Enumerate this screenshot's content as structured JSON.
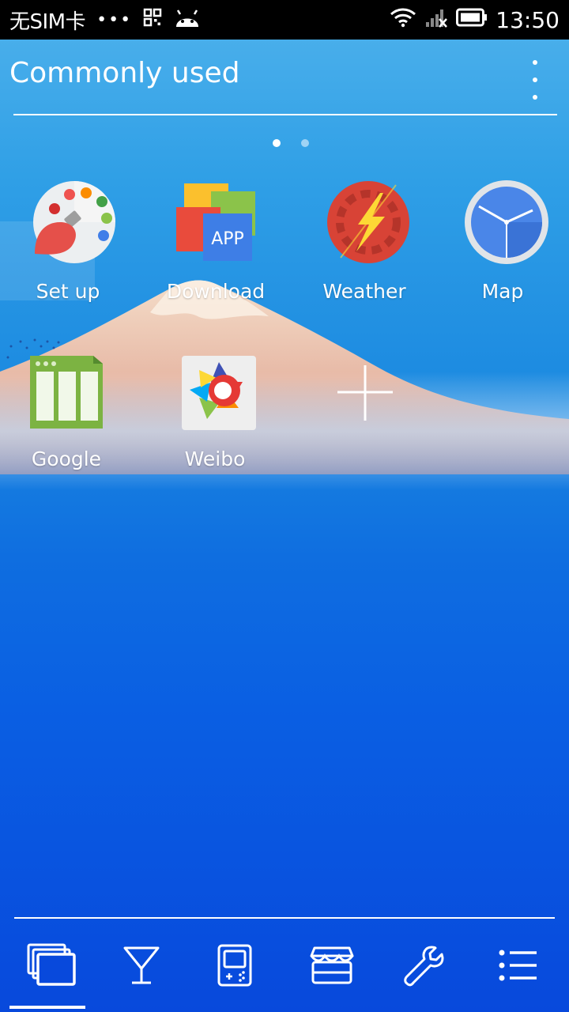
{
  "status_bar": {
    "carrier": "无SIM卡",
    "dots": "•••",
    "time": "13:50"
  },
  "header": {
    "title": "Commonly used",
    "menu_icon": "more-vert-icon"
  },
  "page_indicator": {
    "count": 2,
    "active_index": 0
  },
  "apps": [
    {
      "label": "Set up",
      "icon": "palette-icon"
    },
    {
      "label": "Download",
      "icon": "app-store-icon"
    },
    {
      "label": "Weather",
      "icon": "lightning-gear-icon"
    },
    {
      "label": "Map",
      "icon": "clock-icon"
    },
    {
      "label": "Google",
      "icon": "window-columns-icon"
    },
    {
      "label": "Weibo",
      "icon": "camera-flower-icon"
    }
  ],
  "add_tile": {
    "icon": "plus-icon"
  },
  "dock": {
    "items": [
      {
        "name": "recent-windows",
        "icon": "stacked-windows-icon",
        "active": true
      },
      {
        "name": "drinks",
        "icon": "cocktail-glass-icon",
        "active": false
      },
      {
        "name": "games",
        "icon": "gameboy-icon",
        "active": false
      },
      {
        "name": "store",
        "icon": "storefront-icon",
        "active": false
      },
      {
        "name": "tools",
        "icon": "wrench-icon",
        "active": false
      },
      {
        "name": "list",
        "icon": "list-icon",
        "active": false
      }
    ]
  },
  "colors": {
    "status_bar": "#000000",
    "accent_white": "#ffffff",
    "wallpaper_top": "#4fb2ec",
    "wallpaper_bottom": "#0849dc"
  }
}
